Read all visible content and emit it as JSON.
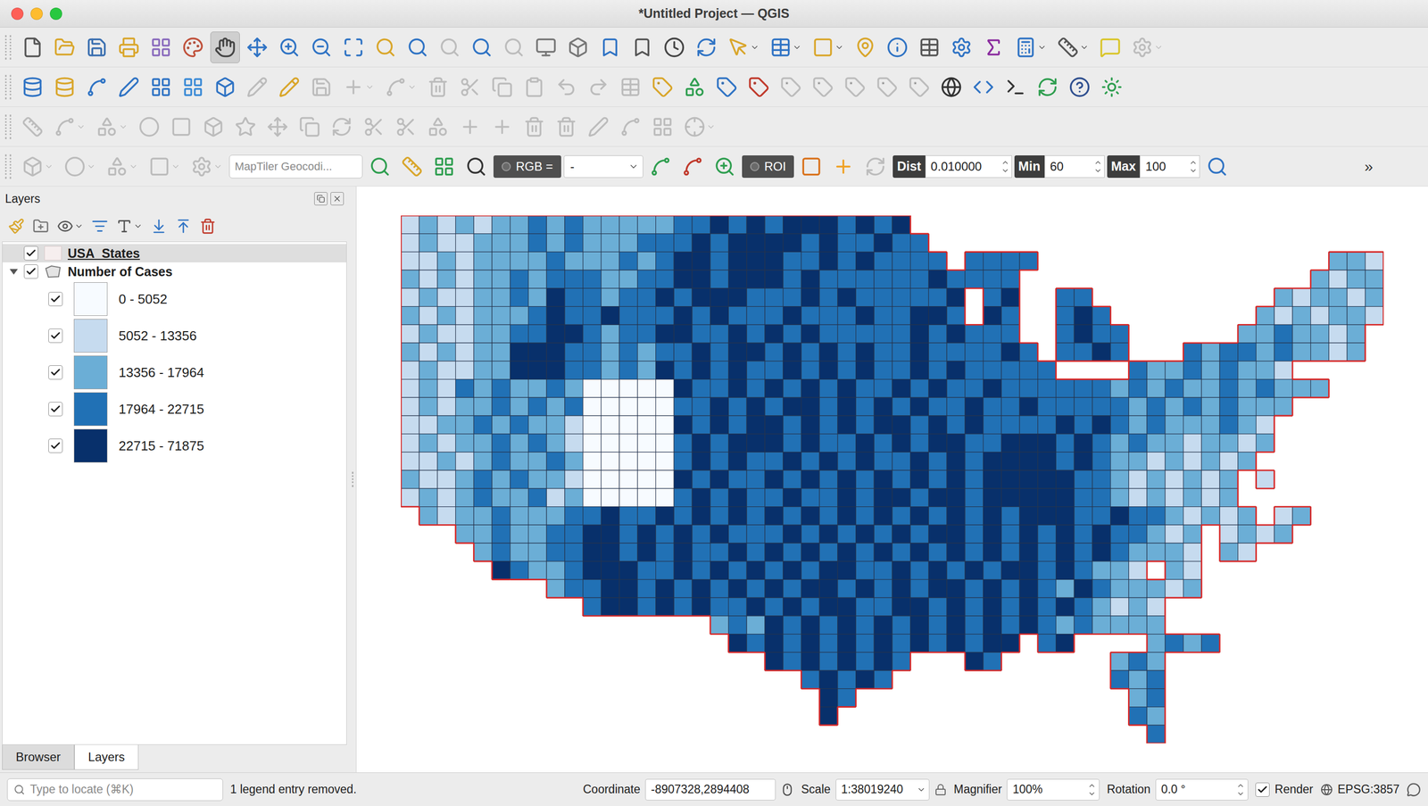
{
  "window": {
    "title": "*Untitled Project — QGIS"
  },
  "toolbars": [
    [
      {
        "selected": false,
        "disabled": false
      },
      {
        "selected": false,
        "disabled": false
      },
      {
        "selected": false,
        "disabled": false
      },
      {
        "selected": false,
        "disabled": false
      },
      {
        "selected": false,
        "disabled": false
      },
      {
        "selected": false,
        "disabled": false
      },
      {
        "selected": true,
        "disabled": false
      },
      {
        "selected": false,
        "disabled": false
      },
      {
        "selected": false,
        "disabled": false
      },
      {
        "selected": false,
        "disabled": false
      },
      {
        "selected": false,
        "disabled": false
      },
      {
        "selected": false,
        "disabled": false
      },
      {
        "selected": false,
        "disabled": false
      },
      {
        "selected": false,
        "disabled": true
      },
      {
        "selected": false,
        "disabled": false
      },
      {
        "selected": false,
        "disabled": true
      },
      {
        "selected": false,
        "disabled": false
      },
      {
        "selected": false,
        "disabled": false
      },
      {
        "selected": false,
        "disabled": false
      },
      {
        "selected": false,
        "disabled": false
      },
      {
        "selected": false,
        "disabled": false
      },
      {
        "selected": false,
        "disabled": false
      },
      {
        "selected": false,
        "disabled": false
      },
      {
        "selected": false,
        "disabled": false
      },
      {
        "selected": false,
        "disabled": false
      },
      {
        "selected": false,
        "disabled": false
      },
      {
        "selected": false,
        "disabled": false
      },
      {
        "selected": false,
        "disabled": false
      },
      {
        "selected": false,
        "disabled": false
      },
      {
        "selected": false,
        "disabled": false
      },
      {
        "selected": false,
        "disabled": false
      },
      {
        "selected": false,
        "disabled": false
      },
      {
        "selected": false,
        "disabled": false
      },
      {
        "selected": false,
        "disabled": true
      }
    ],
    [
      {
        "selected": false,
        "disabled": false
      },
      {
        "selected": false,
        "disabled": false
      },
      {
        "selected": false,
        "disabled": false
      },
      {
        "selected": false,
        "disabled": false
      },
      {
        "selected": false,
        "disabled": false
      },
      {
        "selected": false,
        "disabled": false
      },
      {
        "selected": false,
        "disabled": false
      },
      {
        "selected": false,
        "disabled": true
      },
      {
        "selected": false,
        "disabled": false
      },
      {
        "selected": false,
        "disabled": true
      },
      {
        "selected": false,
        "disabled": true
      },
      {
        "selected": false,
        "disabled": true
      },
      {
        "selected": false,
        "disabled": true
      },
      {
        "selected": false,
        "disabled": true
      },
      {
        "selected": false,
        "disabled": true
      },
      {
        "selected": false,
        "disabled": true
      },
      {
        "selected": false,
        "disabled": true
      },
      {
        "selected": false,
        "disabled": true
      },
      {
        "selected": false,
        "disabled": true
      },
      {
        "selected": false,
        "disabled": false
      },
      {
        "selected": false,
        "disabled": false
      },
      {
        "selected": false,
        "disabled": false
      },
      {
        "selected": false,
        "disabled": false
      },
      {
        "selected": false,
        "disabled": true
      },
      {
        "selected": false,
        "disabled": true
      },
      {
        "selected": false,
        "disabled": true
      },
      {
        "selected": false,
        "disabled": true
      },
      {
        "selected": false,
        "disabled": true
      },
      {
        "selected": false,
        "disabled": false
      },
      {
        "selected": false,
        "disabled": false
      },
      {
        "selected": false,
        "disabled": false
      },
      {
        "selected": false,
        "disabled": false
      },
      {
        "selected": false,
        "disabled": false
      },
      {
        "selected": false,
        "disabled": false
      }
    ],
    [
      {
        "selected": false,
        "disabled": true
      },
      {
        "selected": false,
        "disabled": true
      },
      {
        "selected": false,
        "disabled": true
      },
      {
        "selected": false,
        "disabled": true
      },
      {
        "selected": false,
        "disabled": true
      },
      {
        "selected": false,
        "disabled": true
      },
      {
        "selected": false,
        "disabled": true
      },
      {
        "selected": false,
        "disabled": true
      },
      {
        "selected": false,
        "disabled": true
      },
      {
        "selected": false,
        "disabled": true
      },
      {
        "selected": false,
        "disabled": true
      },
      {
        "selected": false,
        "disabled": true
      },
      {
        "selected": false,
        "disabled": true
      },
      {
        "selected": false,
        "disabled": true
      },
      {
        "selected": false,
        "disabled": true
      },
      {
        "selected": false,
        "disabled": true
      },
      {
        "selected": false,
        "disabled": true
      },
      {
        "selected": false,
        "disabled": true
      },
      {
        "selected": false,
        "disabled": true
      },
      {
        "selected": false,
        "disabled": true
      },
      {
        "selected": false,
        "disabled": true
      }
    ]
  ],
  "plugin_toolbar": [
    {
      "kind": "tool",
      "selected": false,
      "disabled": true
    },
    {
      "kind": "tool",
      "selected": false,
      "disabled": true
    },
    {
      "kind": "tool",
      "selected": false,
      "disabled": true
    },
    {
      "kind": "tool",
      "selected": false,
      "disabled": true
    },
    {
      "kind": "tool",
      "selected": false,
      "disabled": true
    },
    {
      "kind": "field",
      "placeholder": "MapTiler Geocodi..."
    },
    {
      "kind": "tool",
      "selected": false,
      "disabled": false
    },
    {
      "kind": "tool",
      "selected": false,
      "disabled": false
    },
    {
      "kind": "tool",
      "selected": false,
      "disabled": false
    },
    {
      "kind": "tool",
      "selected": false,
      "disabled": false
    },
    {
      "kind": "pill",
      "label": "RGB ="
    },
    {
      "kind": "combo",
      "value": "-"
    },
    {
      "kind": "tool",
      "selected": false,
      "disabled": false
    },
    {
      "kind": "tool",
      "selected": false,
      "disabled": false
    },
    {
      "kind": "tool",
      "selected": false,
      "disabled": false
    },
    {
      "kind": "pill",
      "label": "ROI"
    },
    {
      "kind": "tool",
      "selected": false,
      "disabled": false
    },
    {
      "kind": "tool",
      "selected": false,
      "disabled": false
    },
    {
      "kind": "tool",
      "selected": false,
      "disabled": true
    },
    {
      "kind": "spin",
      "label": "Dist",
      "value": "0.010000"
    },
    {
      "kind": "spin",
      "label": "Min",
      "value": "60"
    },
    {
      "kind": "spin",
      "label": "Max",
      "value": "100"
    },
    {
      "kind": "tool",
      "selected": false,
      "disabled": false
    },
    {
      "kind": "overflow",
      "label": "»"
    }
  ],
  "layers_panel": {
    "title": "Layers",
    "tools": [
      {
        "disabled": false
      },
      {
        "disabled": false
      },
      {
        "disabled": false
      },
      {
        "disabled": false
      },
      {
        "disabled": false
      },
      {
        "disabled": false
      },
      {
        "disabled": false
      },
      {
        "disabled": false
      }
    ],
    "tree": [
      {
        "name": "USA_States",
        "checked": true,
        "selected": true
      },
      {
        "name": "Number of Cases",
        "checked": true,
        "selected": false,
        "expanded": true,
        "legend": [
          {
            "label": "0 - 5052",
            "checked": true,
            "color": "#f7fbff"
          },
          {
            "label": "5052 - 13356",
            "checked": true,
            "color": "#c6dbef"
          },
          {
            "label": "13356 - 17964",
            "checked": true,
            "color": "#6baed6"
          },
          {
            "label": "17964 - 22715",
            "checked": true,
            "color": "#2171b5"
          },
          {
            "label": "22715 - 71875",
            "checked": true,
            "color": "#08306b"
          }
        ]
      }
    ],
    "tabs": [
      {
        "label": "Browser",
        "selected": false
      },
      {
        "label": "Layers",
        "selected": true
      }
    ]
  },
  "map": {
    "class_grid": [
      "1212122323222223343434443434",
      "12112223232223334344443433433",
      "112122223222323443444334343333.3333................221",
      "2121223233322334434443433333343333................2122",
      "1211223243323343444333434333334 34..33..........212212",
      "2121222343343334343334333433443 43..343........2121221",
      "1211223344323344334343433333434333..3433......2232212",
      "21212244433232334344343434334333343.3343...3233232212",
      "121122444332324343433434343343433333....322323221",
      "121323223200000433434343433434334333333232322323222",
      "1212232323000003343434434343433433433333232323222",
      "112232322100000434344343434434343333434323222321",
      "121223232100000343444343343434433444343232212212",
      "11212322320000034343343434334343444434322121212",
      "2112323221000004343343434343434344444332121212 1",
      "1212322312000003434334334344344344444332121212",
      ".2122322233433434343434343434343434443343321212 12",
      "...22322334434343433343434343443434343433212 1212",
      "....2322334434343343434343434343434343432221 21",
      ".....432234443343434343443343434344343221 21",
      "........233443434343434434343443434324322212",
      "..........34434343343434433443434343432121",
      ".................2324343434343434343232222",
      "..................4343434343434344 34....2323",
      "....................43434343...43......232",
      "......................34343............323",
      ".......................43...............23",
      ".......................4................32",
      ".........................................3"
    ]
  },
  "status_bar": {
    "locator_placeholder": "Type to locate (⌘K)",
    "message": "1 legend entry removed.",
    "coordinate_label": "Coordinate",
    "coordinate": "-8907328,2894408",
    "scale_label": "Scale",
    "scale": "1:38019240",
    "magnifier_label": "Magnifier",
    "magnifier": "100%",
    "rotation_label": "Rotation",
    "rotation": "0.0 °",
    "render_label": "Render",
    "render_checked": true,
    "crs": "EPSG:3857"
  }
}
